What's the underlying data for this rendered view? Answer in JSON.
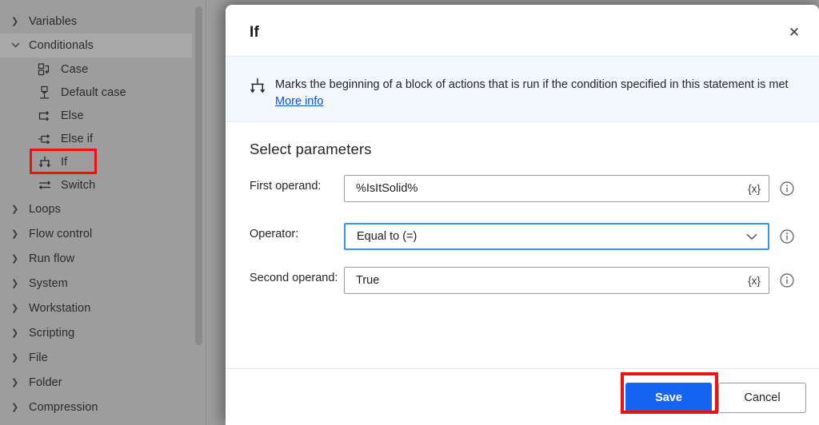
{
  "sidebar": {
    "groups": [
      {
        "label": "Variables",
        "expanded": false,
        "active": false
      },
      {
        "label": "Conditionals",
        "expanded": true,
        "active": true
      },
      {
        "label": "Loops",
        "expanded": false,
        "active": false
      },
      {
        "label": "Flow control",
        "expanded": false,
        "active": false
      },
      {
        "label": "Run flow",
        "expanded": false,
        "active": false
      },
      {
        "label": "System",
        "expanded": false,
        "active": false
      },
      {
        "label": "Workstation",
        "expanded": false,
        "active": false
      },
      {
        "label": "Scripting",
        "expanded": false,
        "active": false
      },
      {
        "label": "File",
        "expanded": false,
        "active": false
      },
      {
        "label": "Folder",
        "expanded": false,
        "active": false
      },
      {
        "label": "Compression",
        "expanded": false,
        "active": false
      }
    ],
    "conditional_items": [
      {
        "label": "Case",
        "icon": "case-icon"
      },
      {
        "label": "Default case",
        "icon": "default-case-icon"
      },
      {
        "label": "Else",
        "icon": "else-icon"
      },
      {
        "label": "Else if",
        "icon": "else-if-icon"
      },
      {
        "label": "If",
        "icon": "if-icon"
      },
      {
        "label": "Switch",
        "icon": "switch-icon"
      }
    ],
    "expand_chevron": "›",
    "collapse_chevron": "⌄",
    "highlighted_item": "If"
  },
  "dialog": {
    "title": "If",
    "close_label": "✕",
    "banner": {
      "icon": "if-icon",
      "text": "Marks the beginning of a block of actions that is run if the condition specified in this statement is met",
      "link_label": "More info"
    },
    "section_title": "Select parameters",
    "fields": [
      {
        "label": "First operand:",
        "value": "%IsItSolid%",
        "placeholder": "",
        "control": "text",
        "trailing_icon": "variable-picker-icon",
        "trailing_label": "{x}",
        "focused": false,
        "info_icon": "info-icon"
      },
      {
        "label": "Operator:",
        "value": "Equal to (=)",
        "placeholder": "",
        "control": "select",
        "trailing_icon": "chevron-down-icon",
        "trailing_label": "",
        "focused": true,
        "info_icon": "info-icon"
      },
      {
        "label": "Second operand:",
        "value": "True",
        "placeholder": "",
        "control": "text",
        "trailing_icon": "variable-picker-icon",
        "trailing_label": "{x}",
        "focused": false,
        "info_icon": "info-icon"
      }
    ],
    "footer": {
      "save_label": "Save",
      "cancel_label": "Cancel"
    }
  },
  "annotations": {
    "highlight_color": "#ee1111",
    "highlighted_targets": [
      "sidebar-item-if",
      "save-button"
    ]
  },
  "colors": {
    "accent_blue": "#1565f2",
    "banner_bg": "#f2f6fd",
    "link_blue": "#1155cc",
    "sidebar_bg": "#9d9d9d",
    "focus_border": "#3b92f0"
  }
}
